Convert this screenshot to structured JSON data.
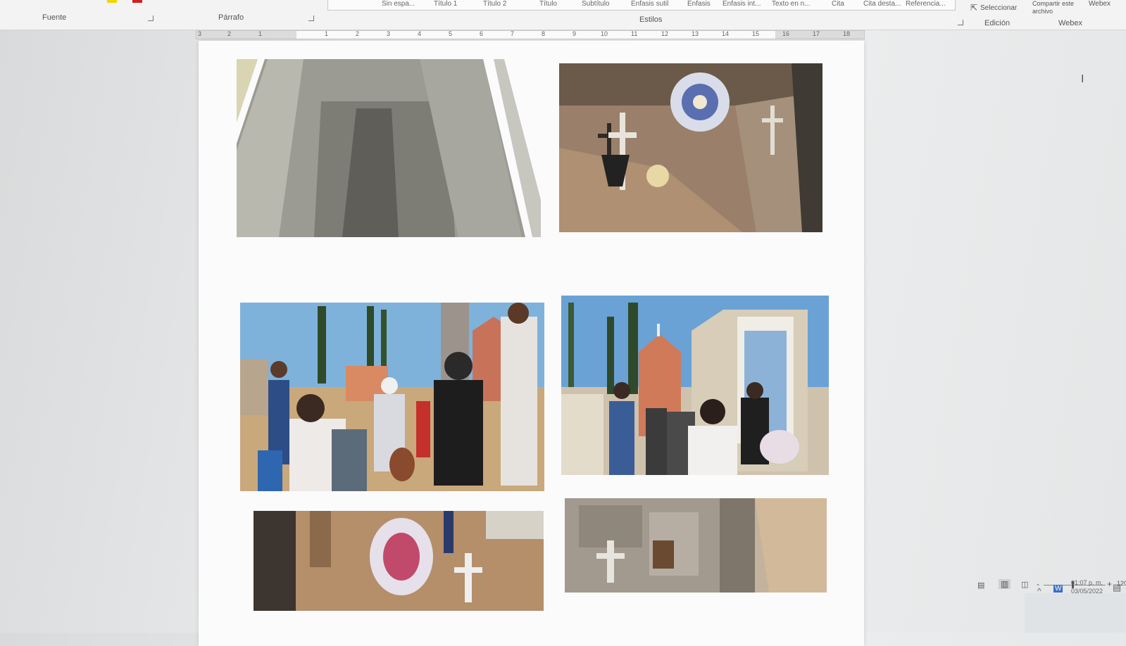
{
  "ribbon": {
    "groups": {
      "fuente": "Fuente",
      "parrafo": "Párrafo",
      "estilos": "Estilos",
      "edicion": "Edición",
      "webex": "Webex"
    },
    "styles": [
      "Sin espa...",
      "Título 1",
      "Título 2",
      "Título",
      "Subtítulo",
      "Énfasis sutil",
      "Énfasis",
      "Énfasis int...",
      "Texto en n...",
      "Cita",
      "Cita desta...",
      "Referencia..."
    ],
    "seleccionar": "Seleccionar",
    "compartir": "Compartir este archivo",
    "webex_btn": "Webex",
    "colors": {
      "highlight": "#f2d600",
      "font_color": "#d21f1f"
    }
  },
  "ruler": {
    "numbers": [
      "3",
      "2",
      "1",
      "1",
      "2",
      "3",
      "4",
      "5",
      "6",
      "7",
      "8",
      "9",
      "10",
      "11",
      "12",
      "13",
      "14",
      "15",
      "16",
      "17",
      "18"
    ]
  },
  "document": {
    "photos": [
      {
        "name": "concrete-crypt-photo",
        "alt": "open concrete crypt"
      },
      {
        "name": "grave-wreath-photo",
        "alt": "grave with flower wreath"
      },
      {
        "name": "cemetery-people-photo",
        "alt": "people gathered in cemetery"
      },
      {
        "name": "cemetery-chapel-photo",
        "alt": "people near chapel"
      },
      {
        "name": "grave-flowers-photo",
        "alt": "grave flowers"
      },
      {
        "name": "crypt-wall-photo",
        "alt": "crypt wall with cross"
      }
    ]
  },
  "statusbar": {
    "zoom": "120",
    "time": "01:07 p. m.",
    "date": "03/05/2022"
  }
}
